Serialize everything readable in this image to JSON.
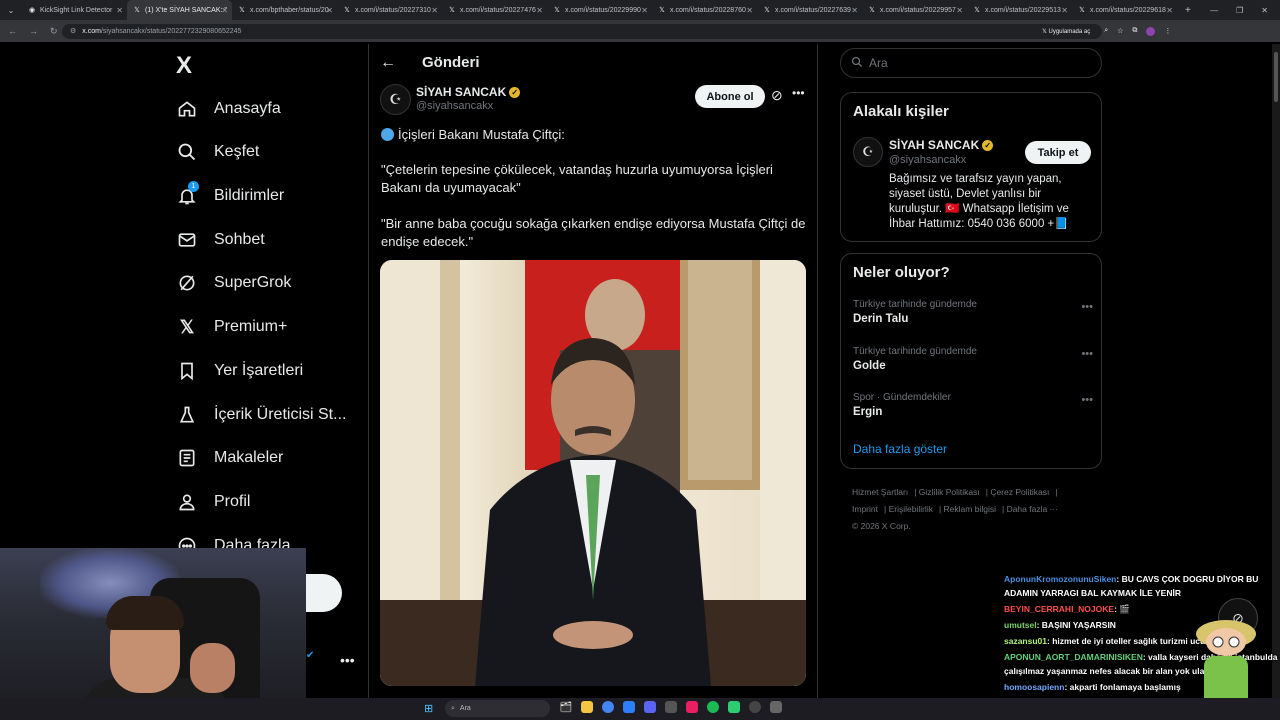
{
  "browser": {
    "tabs": [
      {
        "label": "KickSight Link Detector",
        "active": false
      },
      {
        "label": "(1) X'te SİYAH SANCAK: \"",
        "active": true
      },
      {
        "label": "x.com/bpthaber/status/20",
        "active": false
      },
      {
        "label": "x.com/i/status/20227310",
        "active": false
      },
      {
        "label": "x.com/i/status/20227476",
        "active": false
      },
      {
        "label": "x.com/i/status/20229990",
        "active": false
      },
      {
        "label": "x.com/i/status/20228760",
        "active": false
      },
      {
        "label": "x.com/i/status/20227639",
        "active": false
      },
      {
        "label": "x.com/i/status/20229957",
        "active": false
      },
      {
        "label": "x.com/i/status/20229513",
        "active": false
      },
      {
        "label": "x.com/i/status/20229618",
        "active": false
      }
    ],
    "url_host": "x.com",
    "url_path": "/siyahsancakx/status/2022772329080652245",
    "app_pill": "Uygulamada aç"
  },
  "nav": {
    "logo": "X",
    "items": [
      {
        "label": "Anasayfa",
        "icon": "home-icon"
      },
      {
        "label": "Keşfet",
        "icon": "search-icon"
      },
      {
        "label": "Bildirimler",
        "icon": "bell-icon",
        "badge": "1"
      },
      {
        "label": "Sohbet",
        "icon": "mail-icon"
      },
      {
        "label": "SuperGrok",
        "icon": "grok-icon"
      },
      {
        "label": "Premium+",
        "icon": "x-icon"
      },
      {
        "label": "Yer İşaretleri",
        "icon": "bookmark-icon"
      },
      {
        "label": "İçerik Üreticisi St...",
        "icon": "flask-icon"
      },
      {
        "label": "Makaleler",
        "icon": "article-icon"
      },
      {
        "label": "Profil",
        "icon": "person-icon"
      },
      {
        "label": "Daha fazla",
        "icon": "more-icon"
      }
    ]
  },
  "post": {
    "page_title": "Gönderi",
    "author_name": "SİYAH SANCAK",
    "author_handle": "@siyahsancakx",
    "subscribe_label": "Abone ol",
    "line1": "İçişleri Bakanı Mustafa Çiftçi:",
    "line2": "\"Çetelerin tepesine çökülecek, vatandaş huzurla uyumuyorsa İçişleri Bakanı da uyumayacak\"",
    "line3": "\"Bir anne baba çocuğu sokağa çıkarken endişe ediyorsa Mustafa Çiftçi de endişe edecek.\""
  },
  "sidebar": {
    "search_placeholder": "Ara",
    "related_title": "Alakalı kişiler",
    "related": {
      "name": "SİYAH SANCAK",
      "handle": "@siyahsancakx",
      "follow_label": "Takip et",
      "bio": "Bağımsız ve tarafsız yayın yapan, siyaset üstü, Devlet yanlısı bir kuruluştur. 🇹🇷 Whatsapp İletişim ve İhbar Hattımız: 0540 036 6000 +📘"
    },
    "trends_title": "Neler oluyor?",
    "trends": [
      {
        "context": "Türkiye tarihinde gündemde",
        "name": "Derin Talu"
      },
      {
        "context": "Türkiye tarihinde gündemde",
        "name": "Golde"
      },
      {
        "context": "Spor · Gündemdekiler",
        "name": "Ergin"
      }
    ],
    "show_more": "Daha fazla göster",
    "footer_links": [
      "Hizmet Şartları",
      "Gizlilik Politikası",
      "Çerez Politikası",
      "Imprint",
      "Erişilebilirlik",
      "Reklam bilgisi",
      "Daha fazla ···"
    ],
    "copyright": "© 2026 X Corp."
  },
  "chat": [
    {
      "user": "AponunKromozonunuSiken",
      "text": ": BU CAVS ÇOK DOGRU DİYOR BU ADAMIN YARRAGI BAL KAYMAK İLE YENİR"
    },
    {
      "user": "BEYIN_CERRAHI_NOJOKE",
      "text": ": 🎬"
    },
    {
      "user": "umutsel",
      "text": ": BAŞINI YAŞARSIN"
    },
    {
      "user": "sazansu01",
      "text": ": hizmet de iyi oteller sağlık turizmi ucuz"
    },
    {
      "user": "APONUN_AORT_DAMARINISIKEN",
      "text": ": valla kayseri daha iyi istanbulda çalışılmaz yaşanmaz nefes alacak bir alan yok ulaşım yok"
    },
    {
      "user": "homoosapienn",
      "text": ": akparti fonlamaya başlamış"
    }
  ],
  "taskbar": {
    "search_label": "Ara"
  }
}
